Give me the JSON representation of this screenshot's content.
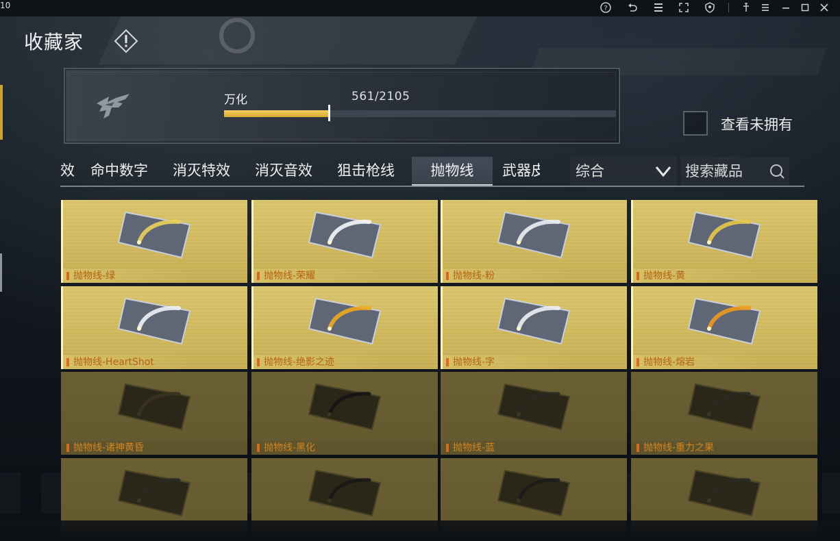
{
  "window": {
    "corner_text": "10"
  },
  "header": {
    "title": "收藏家"
  },
  "progress": {
    "rank": "万化",
    "count_text": "561/2105",
    "owned": 561,
    "total": 2105,
    "bar_fraction": 0.27
  },
  "filter": {
    "show_unowned_label": "查看未拥有",
    "show_unowned_checked": false
  },
  "tabs": [
    {
      "label": "效",
      "active": false
    },
    {
      "label": "命中数字",
      "active": false
    },
    {
      "label": "消灭特效",
      "active": false
    },
    {
      "label": "消灭音效",
      "active": false
    },
    {
      "label": "狙击枪线",
      "active": false
    },
    {
      "label": "抛物线",
      "active": true
    },
    {
      "label": "武器皮",
      "active": false
    }
  ],
  "sort": {
    "selected": "综合"
  },
  "search": {
    "placeholder": "搜索藏品"
  },
  "items": [
    {
      "name": "抛物线-绿",
      "owned": true,
      "trail": "#e9d25a"
    },
    {
      "name": "抛物线-荣耀",
      "owned": true,
      "trail": "#f4f6fa"
    },
    {
      "name": "抛物线-粉",
      "owned": true,
      "trail": "#eceff4"
    },
    {
      "name": "抛物线-黄",
      "owned": true,
      "trail": "#e8c94a"
    },
    {
      "name": "抛物线-HeartShot",
      "owned": true,
      "trail": "#f0f2f6"
    },
    {
      "name": "抛物线-绝影之迹",
      "owned": true,
      "trail": "#f0a820"
    },
    {
      "name": "抛物线-字",
      "owned": true,
      "trail": "#eef0f4"
    },
    {
      "name": "抛物线-熔岩",
      "owned": true,
      "trail": "#f09a1c"
    },
    {
      "name": "抛物线-诸神黄昏",
      "owned": false,
      "trail": "#3a3320"
    },
    {
      "name": "抛物线-黑化",
      "owned": false,
      "trail": "#141414"
    },
    {
      "name": "抛物线-蓝",
      "owned": false,
      "trail": "#2a2a22"
    },
    {
      "name": "抛物线-重力之果",
      "owned": false,
      "trail": "#2a2a22"
    },
    {
      "name": "",
      "owned": false,
      "trail": "#2a2a22"
    },
    {
      "name": "",
      "owned": false,
      "trail": "#181818"
    },
    {
      "name": "",
      "owned": false,
      "trail": "#1c1c1c"
    },
    {
      "name": "",
      "owned": false,
      "trail": "#2a2a22"
    }
  ],
  "colors": {
    "accent_gold": "#d9a92d",
    "card_lit": "#d9c36a",
    "card_dim": "#6b5f34",
    "label_orange": "#b36414"
  },
  "icons": {
    "system": [
      "help-icon",
      "undo-icon",
      "list-icon",
      "fullscreen-icon",
      "shield-icon",
      "pin-icon",
      "menu-icon",
      "minimize-icon",
      "maximize-icon",
      "close-icon"
    ]
  }
}
